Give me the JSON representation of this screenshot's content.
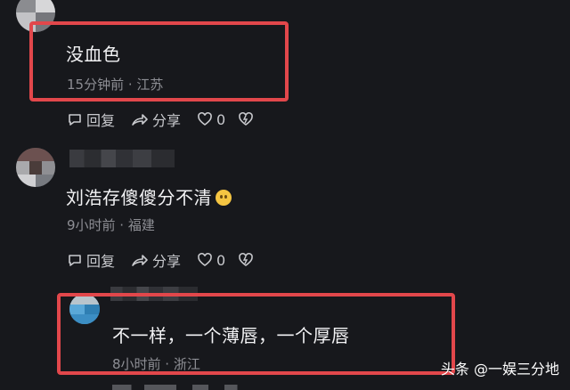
{
  "comments": [
    {
      "text": "没血色",
      "meta": "15分钟前 · 江苏",
      "actions": {
        "reply": "回复",
        "share": "分享",
        "likes": "0"
      }
    },
    {
      "text": "刘浩存傻傻分不清",
      "meta": "9小时前 · 福建",
      "actions": {
        "reply": "回复",
        "share": "分享",
        "likes": "0"
      }
    },
    {
      "text": "不一样，一个薄唇，一个厚唇",
      "meta": "8小时前 · 浙江"
    }
  ],
  "watermark": "头条 @一娱三分地",
  "colors": {
    "highlight": "#e2474b",
    "background": "#17181c"
  }
}
